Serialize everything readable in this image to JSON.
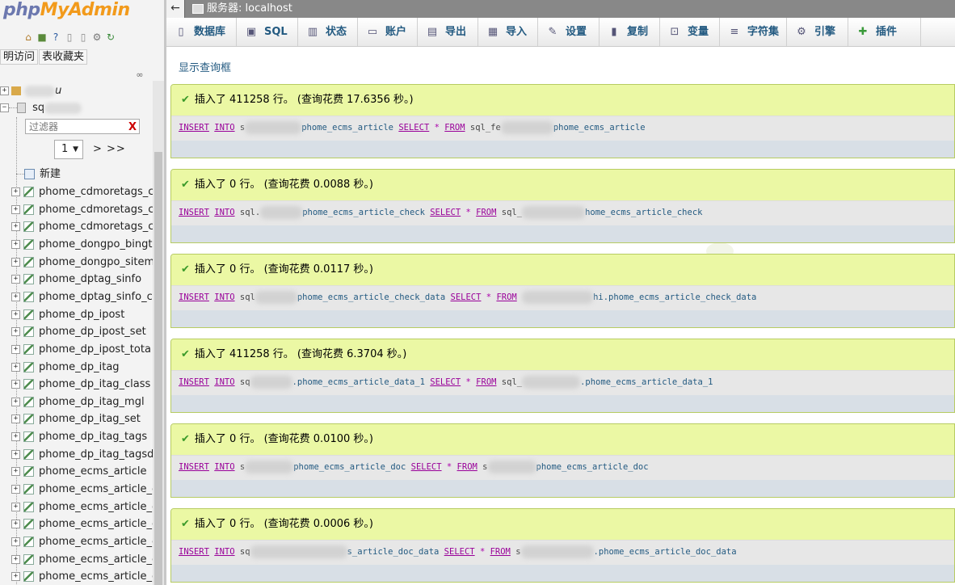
{
  "nav": {
    "logo_php": "php",
    "logo_myadmin": "MyAdmin",
    "icons": [
      "home-icon",
      "exit-icon",
      "help-icon",
      "docs-icon",
      "console-icon",
      "settings-icon",
      "reload-icon"
    ],
    "links": [
      "明访问",
      "表收藏夹"
    ],
    "collapse_symbol": "∞",
    "db_partial_1": "u",
    "db_partial_2": "sq",
    "filter_placeholder": "过滤器",
    "filter_clear": "X",
    "page_value": "1",
    "page_next": "> >>",
    "new_label": "新建",
    "tables": [
      "phome_cdmoretags_c",
      "phome_cdmoretags_c",
      "phome_cdmoretags_c",
      "phome_dongpo_bingt",
      "phome_dongpo_sitem",
      "phome_dptag_sinfo",
      "phome_dptag_sinfo_c",
      "phome_dp_ipost",
      "phome_dp_ipost_set",
      "phome_dp_ipost_tota",
      "phome_dp_itag",
      "phome_dp_itag_class",
      "phome_dp_itag_mgl",
      "phome_dp_itag_set",
      "phome_dp_itag_tags",
      "phome_dp_itag_tagsd",
      "phome_ecms_article",
      "phome_ecms_article_c",
      "phome_ecms_article_c",
      "phome_ecms_article_c",
      "phome_ecms_article_c",
      "phome_ecms_article_c",
      "phome_ecms_article_c"
    ]
  },
  "topbar": {
    "back": "←",
    "server": "服务器: localhost"
  },
  "tabs": [
    {
      "label": "数据库",
      "icon": "database-icon"
    },
    {
      "label": "SQL",
      "icon": "sql-icon"
    },
    {
      "label": "状态",
      "icon": "status-icon"
    },
    {
      "label": "账户",
      "icon": "users-icon"
    },
    {
      "label": "导出",
      "icon": "export-icon"
    },
    {
      "label": "导入",
      "icon": "import-icon"
    },
    {
      "label": "设置",
      "icon": "wrench-icon"
    },
    {
      "label": "复制",
      "icon": "replication-icon"
    },
    {
      "label": "变量",
      "icon": "variables-icon"
    },
    {
      "label": "字符集",
      "icon": "charset-icon"
    },
    {
      "label": "引擎",
      "icon": "engine-icon"
    },
    {
      "label": "插件",
      "icon": "plugin-icon"
    }
  ],
  "main": {
    "show_query": "显示查询框",
    "results": [
      {
        "message": "插入了 411258 行。 (查询花费 17.6356 秒。)",
        "sql": {
          "kw1": "INSERT",
          "kw2": "INTO",
          "a": "s",
          "t1": "phome_ecms_article",
          "kw3": "SELECT",
          "star": "*",
          "kw4": "FROM",
          "b": "sql_fe",
          "t2": "phome_ecms_article"
        }
      },
      {
        "message": "插入了 0 行。 (查询花费 0.0088 秒。)",
        "sql": {
          "kw1": "INSERT",
          "kw2": "INTO",
          "a": "sql.",
          "t1": "phome_ecms_article_check",
          "kw3": "SELECT",
          "star": "*",
          "kw4": "FROM",
          "b": "sql_",
          "t2": "home_ecms_article_check"
        }
      },
      {
        "message": "插入了 0 行。 (查询花费 0.0117 秒。)",
        "sql": {
          "kw1": "INSERT",
          "kw2": "INTO",
          "a": "sql",
          "t1": "phome_ecms_article_check_data",
          "kw3": "SELECT",
          "star": "*",
          "kw4": "FROM",
          "b": "",
          "t2": "hi.phome_ecms_article_check_data"
        }
      },
      {
        "message": "插入了 411258 行。 (查询花费 6.3704 秒。)",
        "sql": {
          "kw1": "INSERT",
          "kw2": "INTO",
          "a": "sq",
          "t1": ".phome_ecms_article_data_1",
          "kw3": "SELECT",
          "star": "*",
          "kw4": "FROM",
          "b": "sql_",
          "t2": ".phome_ecms_article_data_1"
        }
      },
      {
        "message": "插入了 0 行。 (查询花费 0.0100 秒。)",
        "sql": {
          "kw1": "INSERT",
          "kw2": "INTO",
          "a": "s",
          "t1": "phome_ecms_article_doc",
          "kw3": "SELECT",
          "star": "*",
          "kw4": "FROM",
          "b": "s",
          "t2": "phome_ecms_article_doc"
        }
      },
      {
        "message": "插入了 0 行。 (查询花费 0.0006 秒。)",
        "sql": {
          "kw1": "INSERT",
          "kw2": "INTO",
          "a": "sq",
          "t1": "s_article_doc_data",
          "kw3": "SELECT",
          "star": "*",
          "kw4": "FROM",
          "b": "s",
          "t2": ".phome_ecms_article_doc_data"
        }
      }
    ]
  }
}
